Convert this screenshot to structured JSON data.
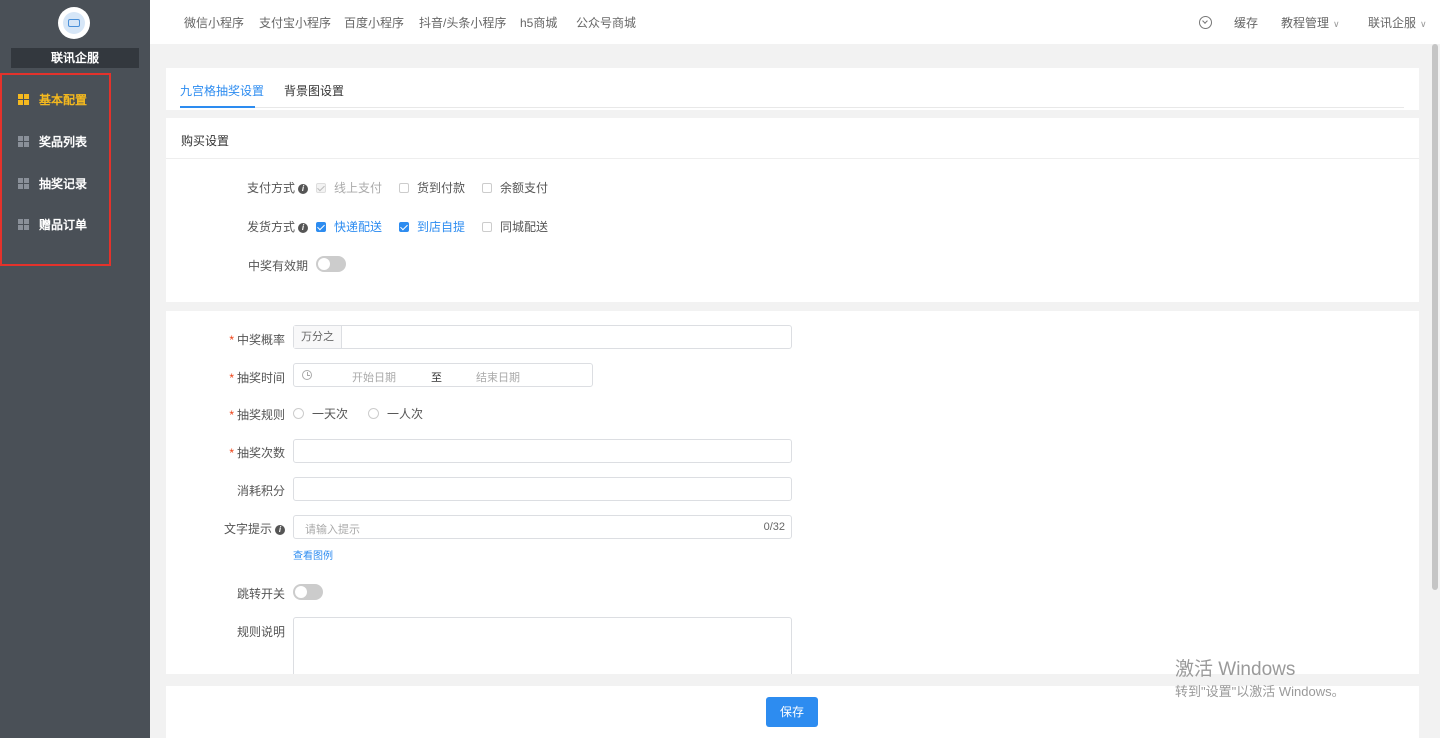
{
  "sidebar": {
    "brand": "联讯企服",
    "items": [
      {
        "label": "基本配置",
        "active": true
      },
      {
        "label": "奖品列表",
        "active": false
      },
      {
        "label": "抽奖记录",
        "active": false
      },
      {
        "label": "赠品订单",
        "active": false
      }
    ]
  },
  "topnav": {
    "links": [
      "微信小程序",
      "支付宝小程序",
      "百度小程序",
      "抖音/头条小程序",
      "h5商城",
      "公众号商城"
    ],
    "cache": "缓存",
    "tutorial": "教程管理",
    "user": "联讯企服"
  },
  "tabs": [
    "九宫格抽奖设置",
    "背景图设置"
  ],
  "purchase": {
    "title": "购买设置",
    "payment_label": "支付方式",
    "payment_options": [
      "线上支付",
      "货到付款",
      "余额支付"
    ],
    "delivery_label": "发货方式",
    "delivery_options": [
      "快递配送",
      "到店自提",
      "同城配送"
    ],
    "validity_label": "中奖有效期"
  },
  "form": {
    "probability_label": "中奖概率",
    "probability_addon": "万分之",
    "time_label": "抽奖时间",
    "start_placeholder": "开始日期",
    "range_sep": "至",
    "end_placeholder": "结束日期",
    "rule_label": "抽奖规则",
    "rule_options": [
      "一天次",
      "一人次"
    ],
    "times_label": "抽奖次数",
    "points_label": "消耗积分",
    "hint_label": "文字提示",
    "hint_placeholder": "请输入提示",
    "hint_count": "0/32",
    "view_example": "查看图例",
    "jump_label": "跳转开关",
    "desc_label": "规则说明"
  },
  "footer": {
    "save": "保存"
  },
  "watermark": {
    "line1": "激活 Windows",
    "line2": "转到\"设置\"以激活 Windows。"
  }
}
